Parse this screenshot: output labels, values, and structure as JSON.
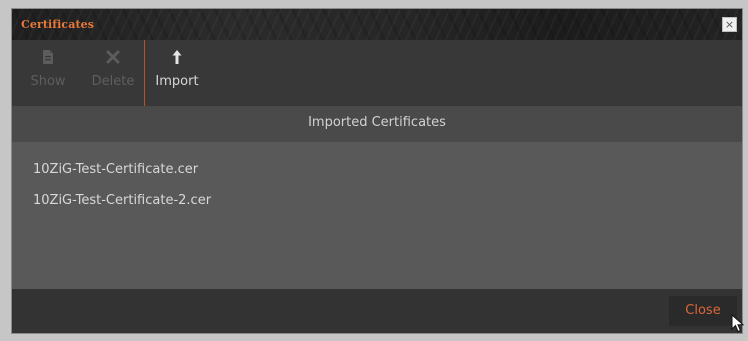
{
  "dialog": {
    "title": "Certificates",
    "close_glyph": "×"
  },
  "toolbar": {
    "show": {
      "label": "Show",
      "icon": "document-icon",
      "enabled": false
    },
    "delete": {
      "label": "Delete",
      "icon": "x-icon",
      "enabled": false
    },
    "import": {
      "label": "Import",
      "icon": "upload-arrow-icon",
      "enabled": true
    }
  },
  "list": {
    "header": "Imported Certificates",
    "items": [
      {
        "name": "10ZiG-Test-Certificate.cer"
      },
      {
        "name": "10ZiG-Test-Certificate-2.cer"
      }
    ]
  },
  "footer": {
    "close_label": "Close"
  },
  "colors": {
    "accent": "#e8793a",
    "background": "#3b3b3b",
    "list_background": "#595959"
  }
}
